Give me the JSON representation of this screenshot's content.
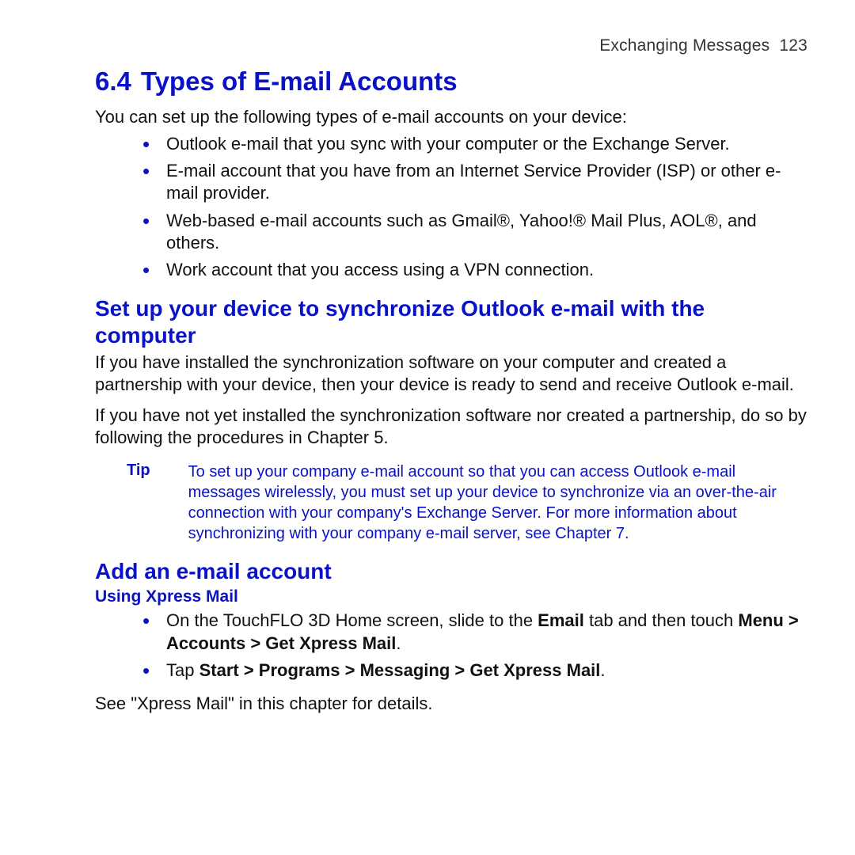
{
  "header": {
    "chapter": "Exchanging Messages",
    "page_no": "123"
  },
  "section": {
    "number": "6.4",
    "title": "Types of E-mail Accounts"
  },
  "intro": "You can set up the following types of e-mail accounts on your device:",
  "account_types": [
    "Outlook e-mail that you sync with your computer or the Exchange Server.",
    "E-mail account that you have from an Internet Service Provider (ISP) or other e-mail provider.",
    "Web-based e-mail accounts such as Gmail®, Yahoo!® Mail Plus, AOL®, and others.",
    "Work account that you access using a VPN connection."
  ],
  "sync": {
    "heading": "Set up your device to synchronize Outlook e-mail with the computer",
    "para1": "If you have installed the synchronization software on your computer and created a partnership with your device, then your device is ready to send and receive Outlook e-mail.",
    "para2": "If you have not yet installed the synchronization software nor created a partnership, do so by following the procedures in Chapter 5."
  },
  "tip": {
    "label": "Tip",
    "body": "To set up your company e-mail account so that you can access Outlook e-mail messages wirelessly, you must set up your device to synchronize via an over-the-air connection with your company's Exchange Server. For more information about synchronizing with your company e-mail server, see Chapter 7."
  },
  "add": {
    "heading": "Add an e-mail account",
    "xpress_heading": "Using Xpress Mail",
    "bullet1_pre": "On the TouchFLO 3D Home screen, slide to the ",
    "bullet1_bold1": "Email",
    "bullet1_mid": " tab and then touch ",
    "bullet1_bold2": "Menu > Accounts > Get Xpress Mail",
    "bullet1_post": ".",
    "bullet2_pre": "Tap ",
    "bullet2_bold": "Start > Programs > Messaging > Get Xpress Mail",
    "bullet2_post": ".",
    "closing": "See \"Xpress Mail\" in this chapter for details."
  }
}
